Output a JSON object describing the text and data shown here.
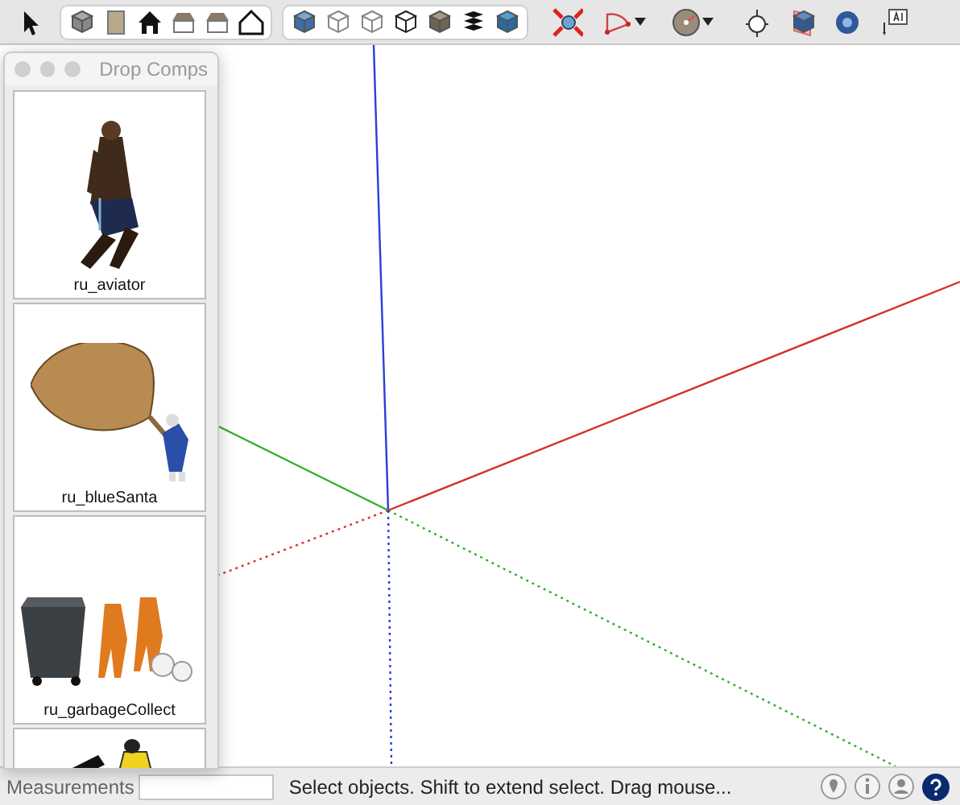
{
  "palette": {
    "title": "Drop Comps",
    "components": [
      {
        "name": "ru_aviator",
        "kind": "picture"
      },
      {
        "name": "ru_blueSanta",
        "kind": "picture"
      },
      {
        "name": "ru_garbageCollect",
        "kind": "picture"
      },
      {
        "kind": "picture"
      }
    ]
  },
  "status_bar": {
    "label": "Measurements",
    "message": "Select objects. Shift to extend select. Drag mouse..."
  }
}
